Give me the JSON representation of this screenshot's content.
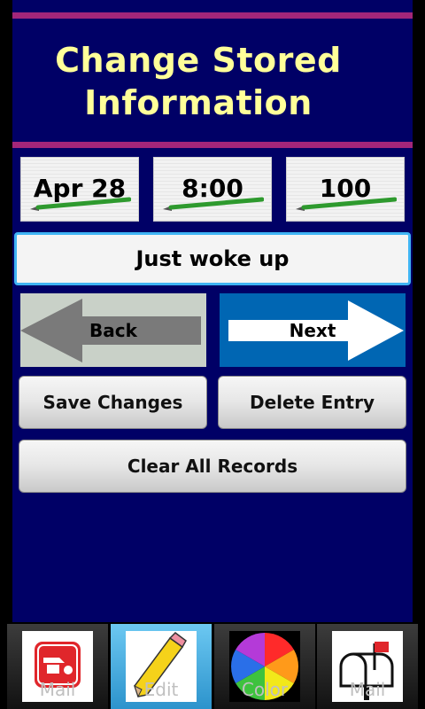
{
  "header": {
    "title_line1": "Change Stored",
    "title_line2": "Information"
  },
  "entry": {
    "date": "Apr 28",
    "time": "8:00",
    "value": "100",
    "note": "Just woke up"
  },
  "nav": {
    "back_label": "Back",
    "next_label": "Next"
  },
  "actions": {
    "save_label": "Save Changes",
    "delete_label": "Delete Entry",
    "clear_label": "Clear All Records"
  },
  "tabs": [
    {
      "label": "Mail",
      "icon": "email-app-icon"
    },
    {
      "label": "Edit",
      "icon": "pencil-icon",
      "active": true
    },
    {
      "label": "Color",
      "icon": "color-wheel-icon"
    },
    {
      "label": "Mail",
      "icon": "mailbox-icon"
    }
  ],
  "colors": {
    "panel": "#000066",
    "title": "#ffff99",
    "accent_bar": "#a3267a",
    "note_border": "#3fb4f4",
    "next_blue": "#0066b3",
    "active_tab": "#3fa9e0"
  }
}
